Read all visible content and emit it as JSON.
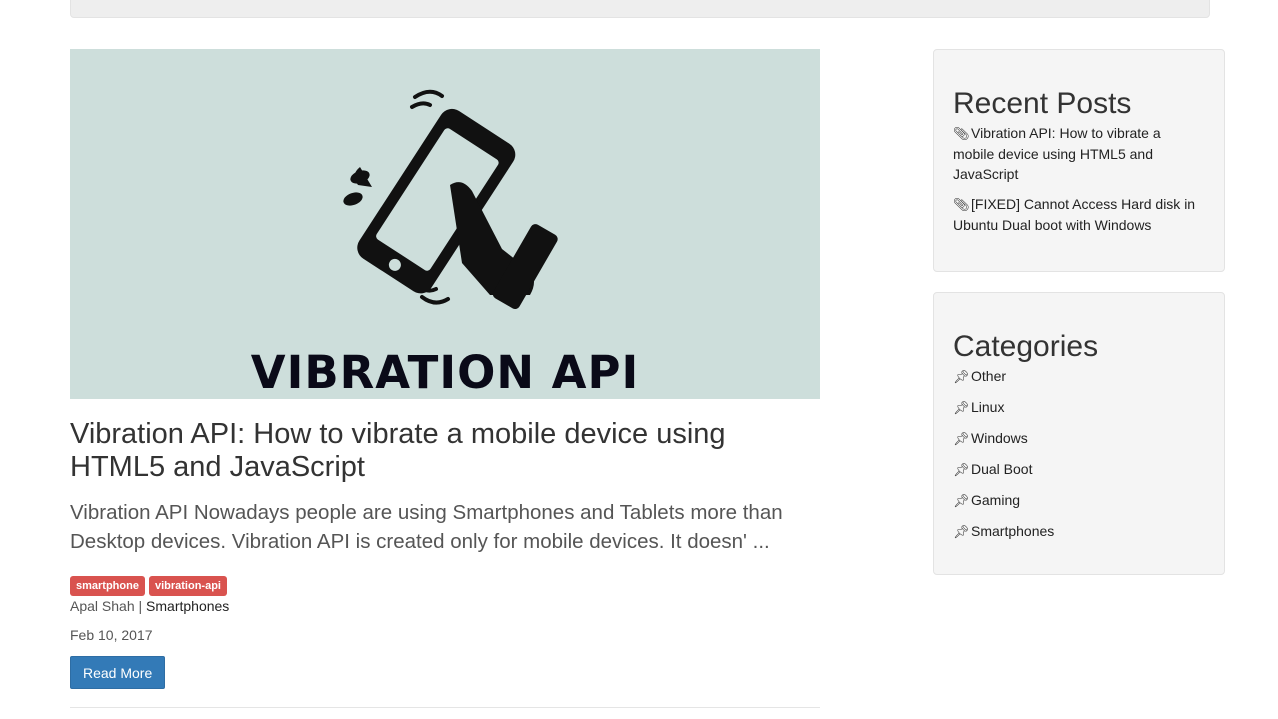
{
  "post": {
    "image_caption": "VIBRATION API",
    "title": "Vibration API: How to vibrate a mobile device using HTML5 and JavaScript",
    "excerpt": "Vibration API Nowadays people are using Smartphones and Tablets more than Desktop devices. Vibration API is created only for mobile devices. It doesn' ...",
    "tags": [
      "smartphone",
      "vibration-api"
    ],
    "author": "Apal Shah",
    "separator": "|",
    "category": "Smartphones",
    "date": "Feb 10, 2017",
    "read_more_label": "Read More"
  },
  "sidebar": {
    "recent_posts": {
      "title": "Recent Posts",
      "icon": "paperclip-icon",
      "items": [
        "Vibration API: How to vibrate a mobile device using HTML5 and JavaScript",
        "[FIXED] Cannot Access Hard disk in Ubuntu Dual boot with Windows"
      ]
    },
    "categories": {
      "title": "Categories",
      "icon": "pushpin-icon",
      "items": [
        "Other",
        "Linux",
        "Windows",
        "Dual Boot",
        "Gaming",
        "Smartphones"
      ]
    }
  },
  "colors": {
    "tag_bg": "#d9534f",
    "button_bg": "#337ab7",
    "hero_bg": "#cddedb"
  }
}
